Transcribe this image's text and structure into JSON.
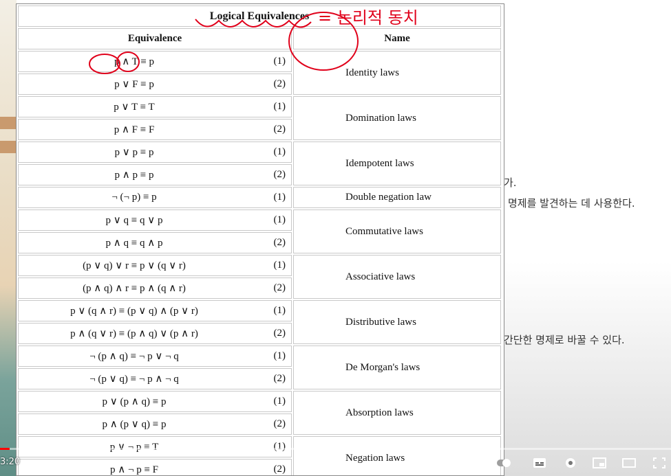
{
  "title": "Logical Equivalences",
  "handwriting": "= 논리적 동치",
  "columns": {
    "equivalence": "Equivalence",
    "name": "Name"
  },
  "rows": [
    {
      "expr": "p ∧ T ≡ p",
      "num": "(1)"
    },
    {
      "expr": "p ∨ F ≡ p",
      "num": "(2)"
    },
    {
      "expr": "p ∨ T ≡ T",
      "num": "(1)"
    },
    {
      "expr": "p ∧ F ≡ F",
      "num": "(2)"
    },
    {
      "expr": "p ∨ p ≡ p",
      "num": "(1)"
    },
    {
      "expr": "p ∧ p ≡ p",
      "num": "(2)"
    },
    {
      "expr": "¬ (¬ p) ≡ p",
      "num": "(1)"
    },
    {
      "expr": "p ∨ q ≡ q ∨ p",
      "num": "(1)"
    },
    {
      "expr": "p ∧ q ≡ q ∧ p",
      "num": "(2)"
    },
    {
      "expr": "(p ∨ q) ∨ r ≡ p ∨ (q ∨ r)",
      "num": "(1)"
    },
    {
      "expr": "(p ∧ q) ∧ r ≡ p ∧ (q ∧ r)",
      "num": "(2)"
    },
    {
      "expr": "p ∨ (q ∧ r) ≡ (p ∨ q) ∧ (p ∨ r)",
      "num": "(1)"
    },
    {
      "expr": "p ∧ (q ∨ r) ≡ (p ∧ q) ∨ (p ∧ r)",
      "num": "(2)"
    },
    {
      "expr": "¬ (p ∧ q) ≡ ¬ p ∨ ¬ q",
      "num": "(1)"
    },
    {
      "expr": "¬ (p ∨ q) ≡ ¬ p ∧ ¬ q",
      "num": "(2)"
    },
    {
      "expr": "p ∨ (p ∧ q) ≡ p",
      "num": "(1)"
    },
    {
      "expr": "p ∧ (p ∨ q) ≡ p",
      "num": "(2)"
    },
    {
      "expr": "p ∨ ¬ p ≡ T",
      "num": "(1)"
    },
    {
      "expr": "p ∧ ¬ p ≡ F",
      "num": "(2)"
    }
  ],
  "names": [
    "Identity laws",
    "Domination laws",
    "Idempotent laws",
    "Double negation law",
    "Commutative laws",
    "Associative laws",
    "Distributive laws",
    "De Morgan's laws",
    "Absorption laws",
    "Negation laws"
  ],
  "background_text": {
    "line1": "가.",
    "line2": "명제를 발견하는 데 사용한다.",
    "line3": "간단한 명제로 바꿀 수 있다."
  },
  "player": {
    "time": "3:20",
    "played_fraction": 0.014,
    "accent": "#ff0000"
  },
  "colors": {
    "ink": "#e0001a"
  }
}
